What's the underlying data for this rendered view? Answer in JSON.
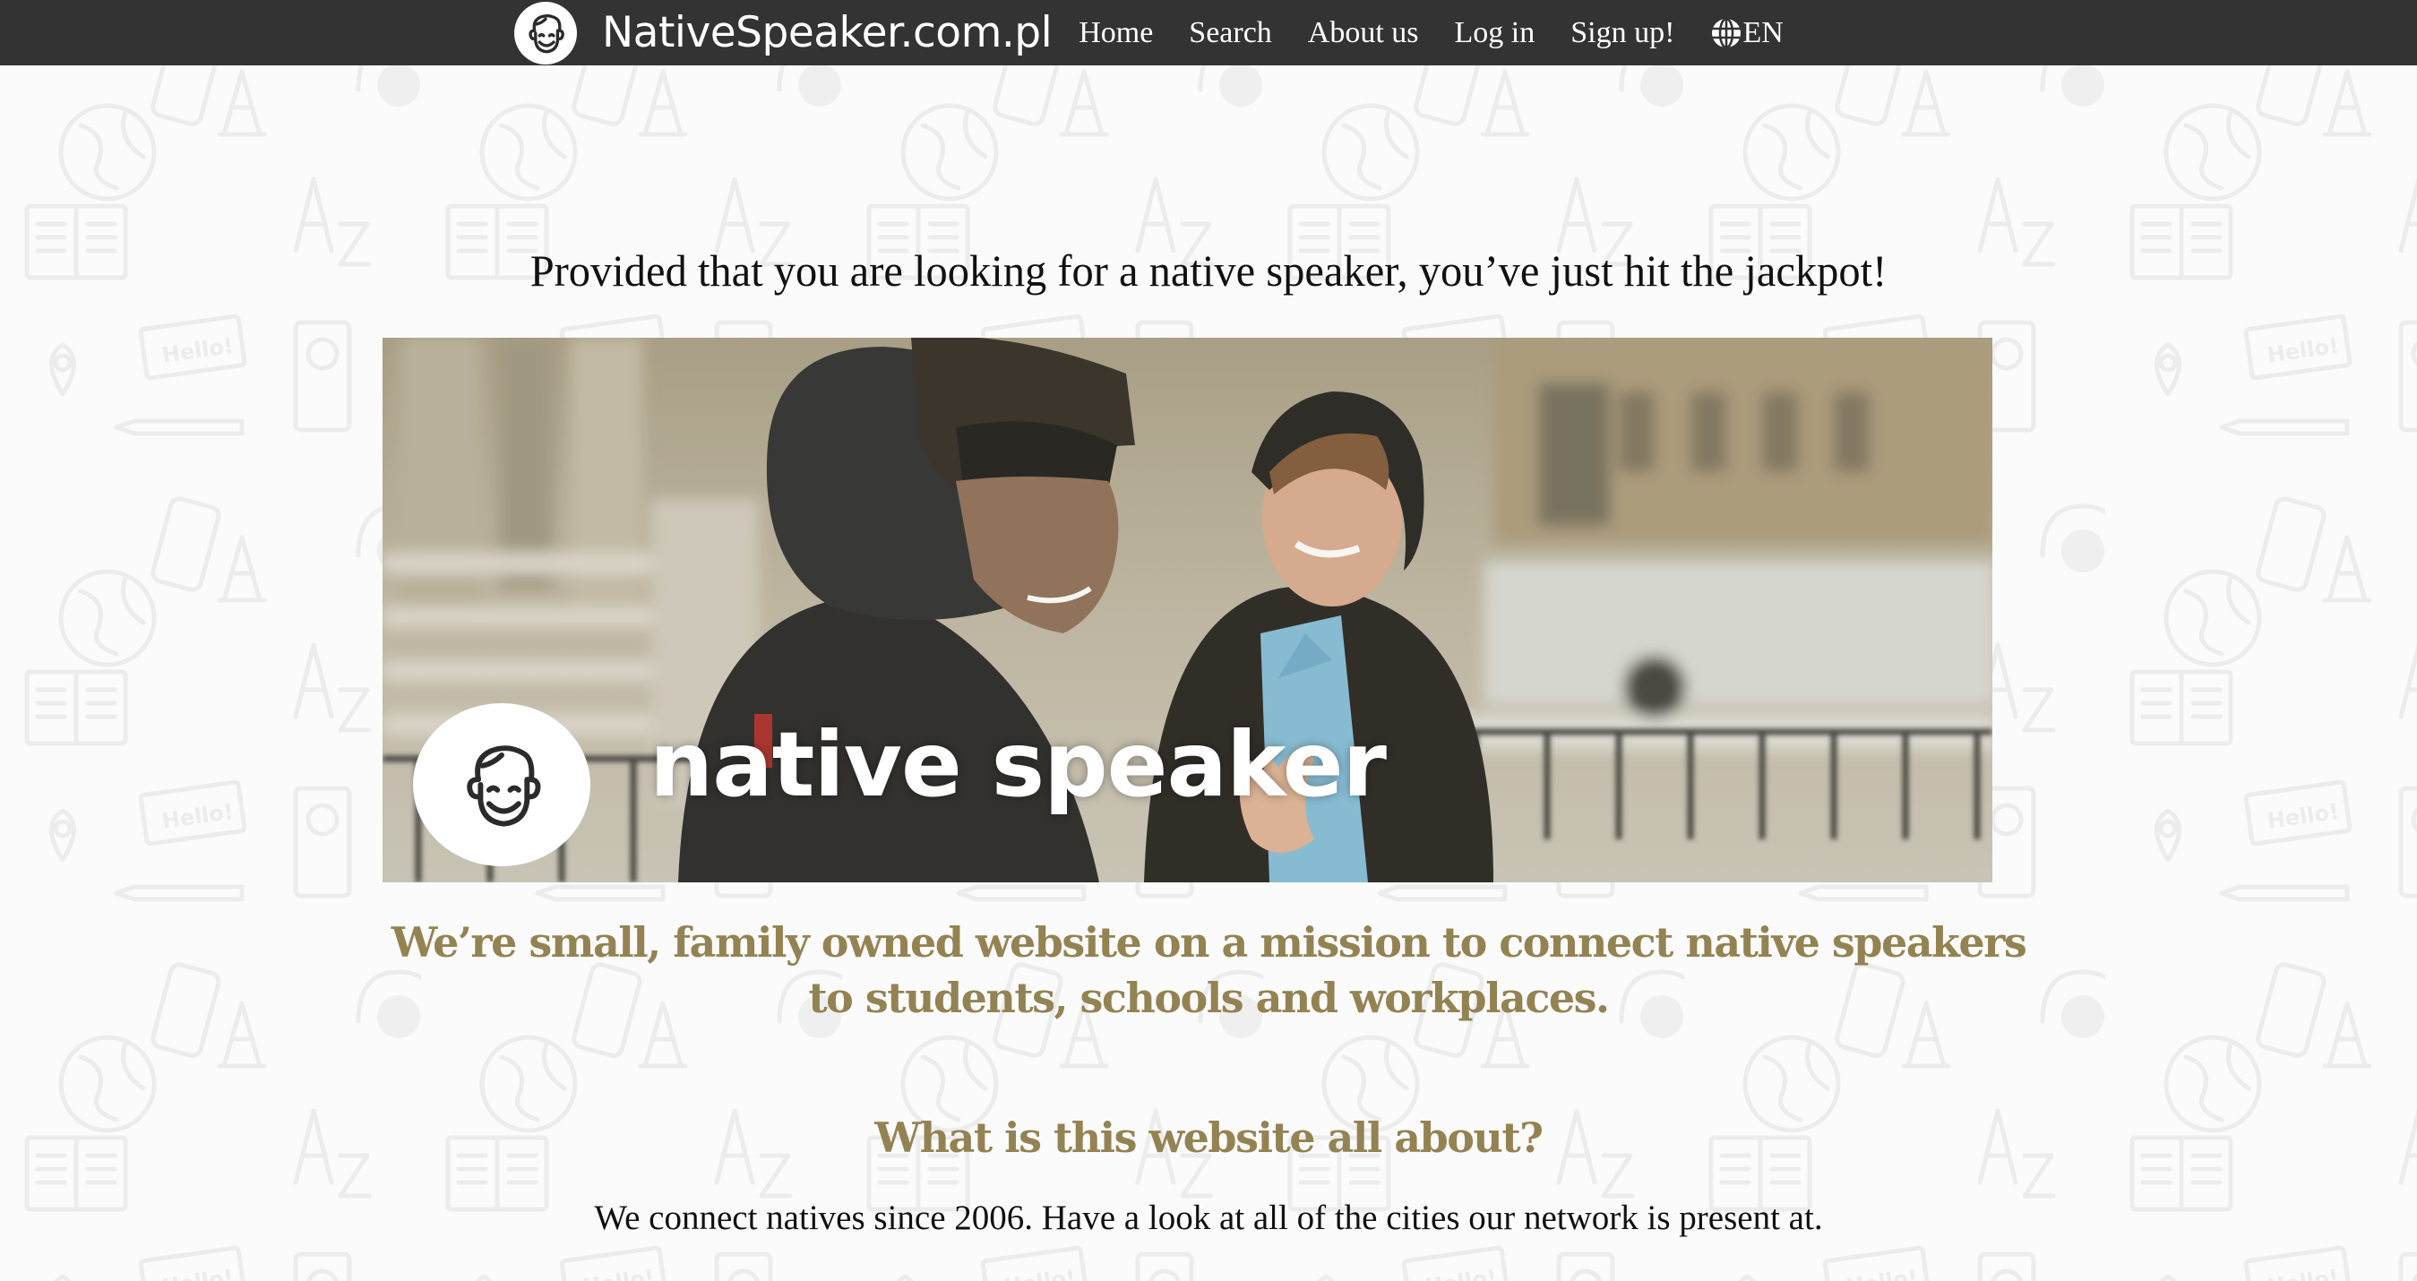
{
  "nav": {
    "brand": "NativeSpeaker.com.pl",
    "logo_icon": "smiling-face-icon",
    "links": [
      {
        "label": "Home"
      },
      {
        "label": "Search"
      },
      {
        "label": "About us"
      },
      {
        "label": "Log in"
      },
      {
        "label": "Sign up!"
      }
    ],
    "language": {
      "icon": "globe-icon",
      "label": "EN"
    }
  },
  "hero": {
    "headline": "Provided that you are looking for a native speaker, you’ve just hit the jackpot!",
    "banner": {
      "logo_icon": "smiling-face-icon",
      "text": "native speaker"
    }
  },
  "mission": {
    "text": "We’re small, family owned website on a mission to connect native speakers to students, schools and workplaces."
  },
  "about": {
    "title": "What is this website all about?",
    "text": "We connect natives since 2006. Have a look at all of the cities our network is present at."
  },
  "colors": {
    "nav_bg": "#333333",
    "accent_gold": "#948352",
    "text": "#111111",
    "page_bg": "#fbfbfb"
  }
}
